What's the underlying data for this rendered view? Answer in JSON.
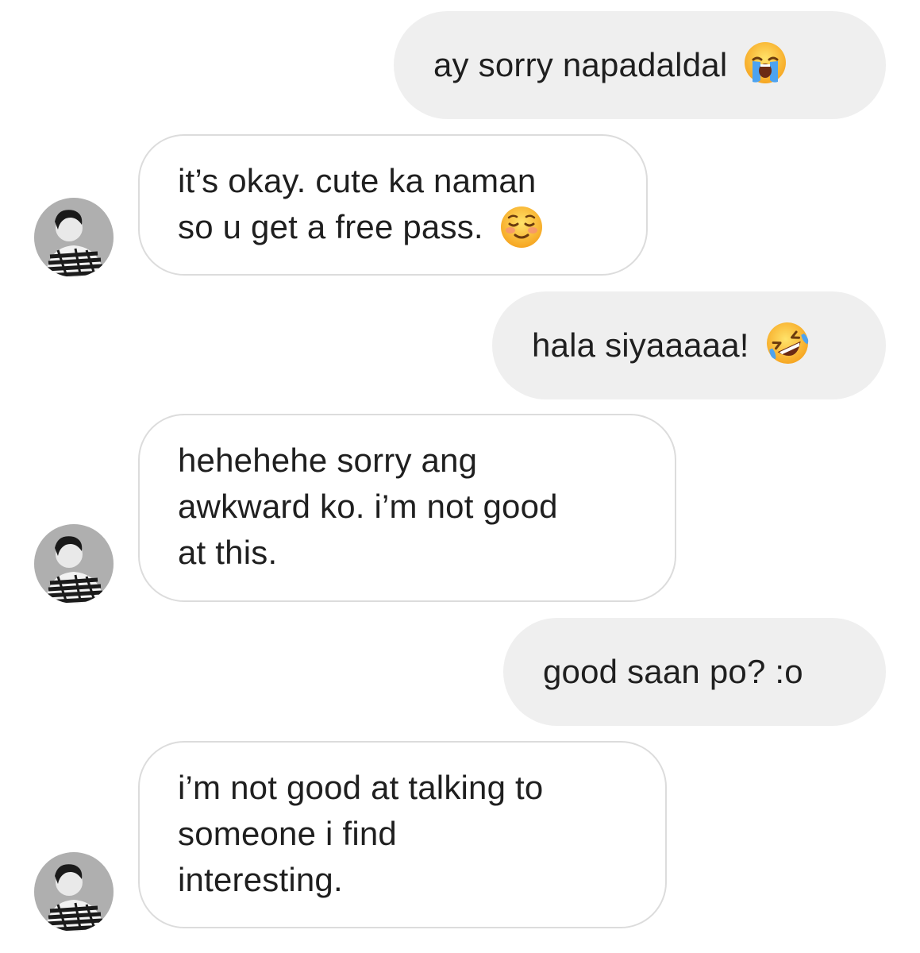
{
  "conversation": {
    "messages": [
      {
        "from": "me",
        "lines": [
          "ay sorry napadaldal"
        ],
        "emoji": "loudly-crying-face"
      },
      {
        "from": "them",
        "lines": [
          "it’s okay. cute ka naman",
          "so u get a free pass."
        ],
        "emoji": "smiling-face"
      },
      {
        "from": "me",
        "lines": [
          "hala siyaaaaa!"
        ],
        "emoji": "rolling-on-floor-laughing"
      },
      {
        "from": "them",
        "lines": [
          "hehehehe sorry ang",
          "awkward ko. i’m not good",
          "at this."
        ]
      },
      {
        "from": "me",
        "lines": [
          "good saan po? :o"
        ]
      },
      {
        "from": "them",
        "lines": [
          "i’m not good at talking to",
          "someone i find",
          "interesting."
        ]
      }
    ]
  },
  "colors": {
    "sent_bubble": "#efefef",
    "received_border": "#dcdcdc",
    "text": "#1f1f1f"
  }
}
